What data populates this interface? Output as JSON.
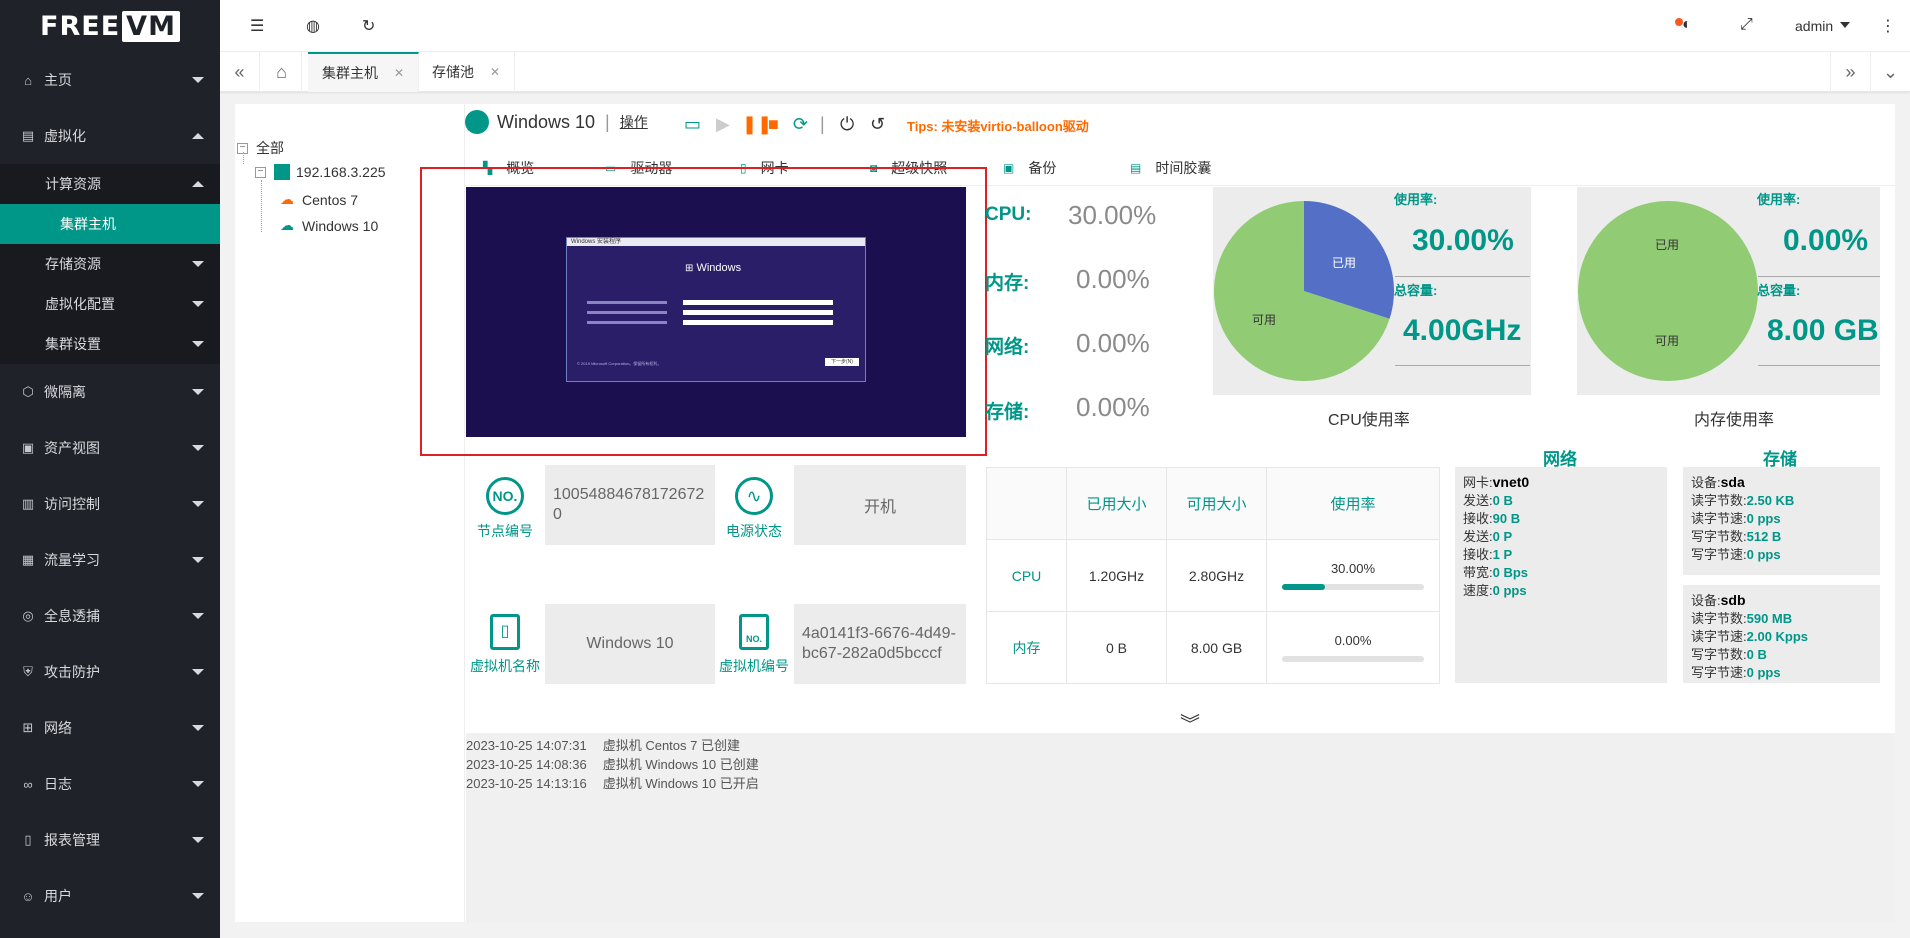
{
  "brand": {
    "logo_free": "FREE",
    "logo_vm": "VM"
  },
  "sidebar": {
    "items": [
      {
        "label": "主页",
        "icon": "home-icon"
      },
      {
        "label": "虚拟化",
        "icon": "virtualization-icon"
      },
      {
        "label": "微隔离",
        "icon": "cube-icon"
      },
      {
        "label": "资产视图",
        "icon": "assets-icon"
      },
      {
        "label": "访问控制",
        "icon": "access-icon"
      },
      {
        "label": "流量学习",
        "icon": "traffic-icon"
      },
      {
        "label": "全息透捕",
        "icon": "capture-icon"
      },
      {
        "label": "攻击防护",
        "icon": "defense-icon"
      },
      {
        "label": "网络",
        "icon": "network-icon"
      },
      {
        "label": "日志",
        "icon": "log-icon"
      },
      {
        "label": "报表管理",
        "icon": "report-icon"
      },
      {
        "label": "用户",
        "icon": "user-icon"
      }
    ],
    "sub": {
      "compute": "计算资源",
      "cluster_host": "集群主机",
      "storage": "存储资源",
      "virt_config": "虚拟化配置",
      "cluster_settings": "集群设置"
    }
  },
  "header": {
    "user": "admin"
  },
  "tabs": [
    {
      "label": "集群主机"
    },
    {
      "label": "存储池"
    }
  ],
  "tree": {
    "root": "全部",
    "host": "192.168.3.225",
    "vms": [
      "Centos 7",
      "Windows 10"
    ]
  },
  "vm": {
    "name": "Windows 10",
    "operate": "操作",
    "tips": "Tips: 未安装virtio-balloon驱动"
  },
  "subtabs": [
    "概览",
    "驱动器",
    "网卡",
    "超级快照",
    "备份",
    "时间胶囊"
  ],
  "screen": {
    "window_title": "Windows 安装程序",
    "brand": "Windows",
    "next_button": "下一步(N)",
    "copyright": "© 2019 Microsoft Corporation。保留所有权利。"
  },
  "stats": {
    "cpu_label": "CPU:",
    "cpu_value": "30.00%",
    "mem_label": "内存:",
    "mem_value": "0.00%",
    "net_label": "网络:",
    "net_value": "0.00%",
    "storage_label": "存储:",
    "storage_value": "0.00%"
  },
  "cpu_panel": {
    "usage_label": "使用率:",
    "usage_value": "30.00%",
    "total_label": "总容量:",
    "total_value": "4.00GHz",
    "caption": "CPU使用率",
    "pie_used_label": "已用",
    "pie_free_label": "可用",
    "used_fraction": 0.3
  },
  "mem_panel": {
    "usage_label": "使用率:",
    "usage_value": "0.00%",
    "total_label": "总容量:",
    "total_value": "8.00 GB",
    "caption": "内存使用率",
    "pie_used_label": "已用",
    "pie_free_label": "可用",
    "used_fraction": 0.0
  },
  "colors": {
    "accent": "#009688",
    "pie_used": "#5470c6",
    "pie_free": "#91cc75",
    "tips": "#ff6a00"
  },
  "info": {
    "node_no_label": "节点编号",
    "node_no_value": "100548846781726720",
    "power_label": "电源状态",
    "power_value": "开机",
    "vm_name_label": "虚拟机名称",
    "vm_name_value": "Windows 10",
    "vm_no_label": "虚拟机编号",
    "vm_no_value": "4a0141f3-6676-4d49-bc67-282a0d5bcccf",
    "no_icon_text": "NO."
  },
  "resources": {
    "headers": [
      "",
      "已用大小",
      "可用大小",
      "使用率"
    ],
    "rows": [
      {
        "name": "CPU",
        "used": "1.20GHz",
        "free": "2.80GHz",
        "rate": "30.00%",
        "rate_fraction": 0.3
      },
      {
        "name": "内存",
        "used": "0 B",
        "free": "8.00 GB",
        "rate": "0.00%",
        "rate_fraction": 0.0
      }
    ]
  },
  "network": {
    "title": "网络",
    "nic_label": "网卡:",
    "nic": "vnet0",
    "lines": [
      {
        "k": "发送:",
        "v": "0 B"
      },
      {
        "k": "接收:",
        "v": "90 B"
      },
      {
        "k": "发送:",
        "v": "0 P"
      },
      {
        "k": "接收:",
        "v": "1 P"
      },
      {
        "k": "带宽:",
        "v": "0 Bps"
      },
      {
        "k": "速度:",
        "v": "0 pps"
      }
    ]
  },
  "storage": {
    "title": "存储",
    "devices": [
      {
        "label": "设备:",
        "name": "sda",
        "lines": [
          {
            "k": "读字节数:",
            "v": "2.50 KB"
          },
          {
            "k": "读字节速:",
            "v": "0 pps"
          },
          {
            "k": "写字节数:",
            "v": "512 B"
          },
          {
            "k": "写字节速:",
            "v": "0 pps"
          }
        ]
      },
      {
        "label": "设备:",
        "name": "sdb",
        "lines": [
          {
            "k": "读字节数:",
            "v": "590 MB"
          },
          {
            "k": "读字节速:",
            "v": "2.00 Kpps"
          },
          {
            "k": "写字节数:",
            "v": "0 B"
          },
          {
            "k": "写字节速:",
            "v": "0 pps"
          }
        ]
      }
    ]
  },
  "logs": [
    {
      "time": "2023-10-25 14:07:31",
      "msg": "虚拟机 Centos 7 已创建"
    },
    {
      "time": "2023-10-25 14:08:36",
      "msg": "虚拟机 Windows 10 已创建"
    },
    {
      "time": "2023-10-25 14:13:16",
      "msg": "虚拟机 Windows 10 已开启"
    }
  ]
}
